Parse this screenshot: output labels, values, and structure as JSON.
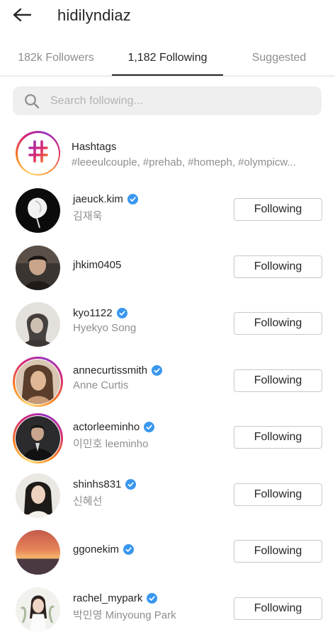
{
  "header": {
    "title": "hidilyndiaz",
    "back_icon": "arrow-left-icon"
  },
  "tabs": [
    {
      "label": "182k Followers",
      "active": false
    },
    {
      "label": "1,182 Following",
      "active": true
    },
    {
      "label": "Suggested",
      "active": false
    }
  ],
  "search": {
    "placeholder": "Search following...",
    "value": ""
  },
  "hashtags": {
    "title": "Hashtags",
    "subtitle": "#leeeulcouple, #prehab, #homeph, #olympicw..."
  },
  "following_label": "Following",
  "users": [
    {
      "username": "jaeuck.kim",
      "subname": "김재욱",
      "verified": true
    },
    {
      "username": "jhkim0405",
      "subname": "",
      "verified": false
    },
    {
      "username": "kyo1122",
      "subname": "Hyekyo Song",
      "verified": true
    },
    {
      "username": "annecurtissmith",
      "subname": "Anne Curtis",
      "verified": true
    },
    {
      "username": "actorleeminho",
      "subname": "이민호 leeminho",
      "verified": true
    },
    {
      "username": "shinhs831",
      "subname": "신혜선",
      "verified": true
    },
    {
      "username": "ggonekim",
      "subname": "",
      "verified": true
    },
    {
      "username": "rachel_mypark",
      "subname": "박민영 Minyoung Park",
      "verified": true
    }
  ],
  "colors": {
    "verified_blue": "#3897f0",
    "text_primary": "#262626",
    "text_secondary": "#8e8e8e"
  }
}
